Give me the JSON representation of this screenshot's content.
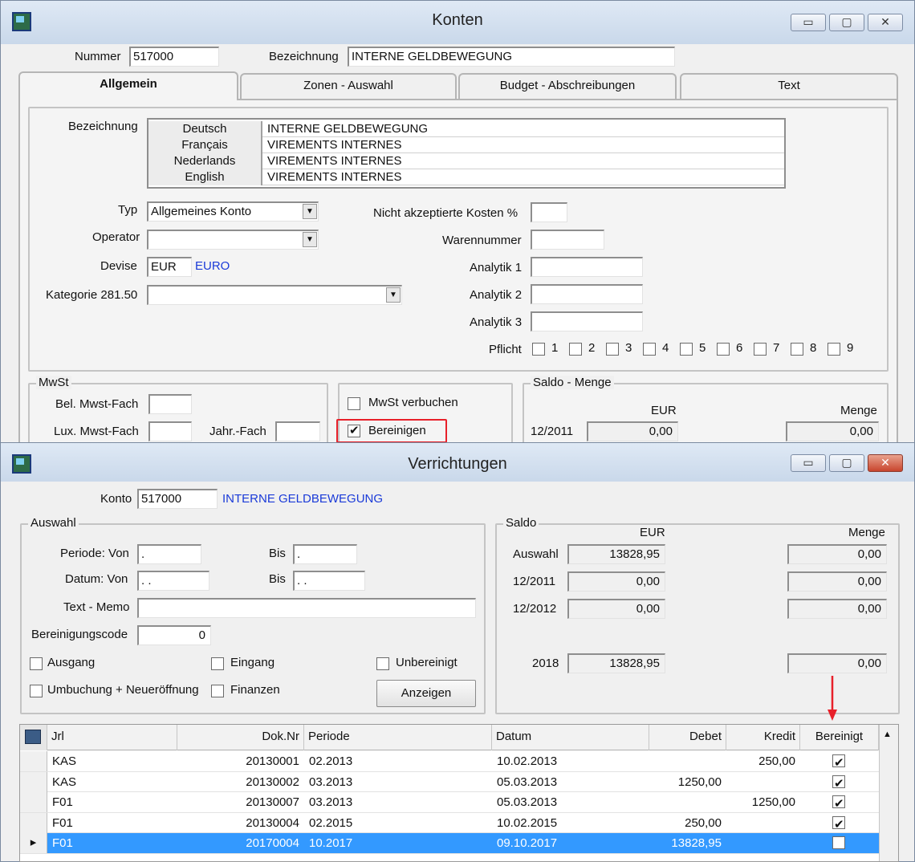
{
  "konten": {
    "title": "Konten",
    "nummer_label": "Nummer",
    "nummer_value": "517000",
    "bezeichnung_label": "Bezeichnung",
    "bezeichnung_value": "INTERNE GELDBEWEGUNG",
    "tabs": [
      "Allgemein",
      "Zonen - Auswahl",
      "Budget - Abschreibungen",
      "Text"
    ],
    "languages_label": "Bezeichnung",
    "languages": [
      {
        "lang": "Deutsch",
        "text": "INTERNE GELDBEWEGUNG"
      },
      {
        "lang": "Français",
        "text": "VIREMENTS INTERNES"
      },
      {
        "lang": "Nederlands",
        "text": "VIREMENTS INTERNES"
      },
      {
        "lang": "English",
        "text": "VIREMENTS INTERNES"
      }
    ],
    "typ_label": "Typ",
    "typ_value": "Allgemeines Konto",
    "operator_label": "Operator",
    "operator_value": "",
    "devise_label": "Devise",
    "devise_code": "EUR",
    "devise_name": "EURO",
    "kategorie_label": "Kategorie 281.50",
    "kategorie_value": "",
    "nicht_label": "Nicht akzeptierte Kosten %",
    "warennummer_label": "Warennummer",
    "analytik_labels": [
      "Analytik 1",
      "Analytik 2",
      "Analytik 3"
    ],
    "pflicht_label": "Pflicht",
    "pflicht_numbers": [
      "1",
      "2",
      "3",
      "4",
      "5",
      "6",
      "7",
      "8",
      "9"
    ],
    "mwst_group": "MwSt",
    "bel_label": "Bel. Mwst-Fach",
    "lux_label": "Lux. Mwst-Fach",
    "jahr_label": "Jahr.-Fach",
    "mwst_verbuchen_label": "MwSt verbuchen",
    "mwst_verbuchen_checked": false,
    "bereinigen_label": "Bereinigen",
    "bereinigen_checked": true,
    "saldo_group": "Saldo - Menge",
    "saldo_eur_header": "EUR",
    "saldo_menge_header": "Menge",
    "saldo_period": "12/2011",
    "saldo_eur": "0,00",
    "saldo_menge": "0,00",
    "highlight_color": "#e8202a"
  },
  "verrichtungen": {
    "title": "Verrichtungen",
    "konto_label": "Konto",
    "konto_value": "517000",
    "konto_name": "INTERNE GELDBEWEGUNG",
    "auswahl_group": "Auswahl",
    "periode_label": "Periode: Von",
    "periode_von": ".",
    "periode_bis": ".",
    "bis_label": "Bis",
    "datum_label": "Datum: Von",
    "datum_von": ". .",
    "datum_bis": ". .",
    "memo_label": "Text - Memo",
    "bereinigungscode_label": "Bereinigungscode",
    "bereinigungscode_value": "0",
    "filters": {
      "ausgang": "Ausgang",
      "eingang": "Eingang",
      "unbereinigt": "Unbereinigt",
      "umbuchung": "Umbuchung + Neueröffnung",
      "finanzen": "Finanzen"
    },
    "anzeigen_label": "Anzeigen",
    "saldo_group": "Saldo",
    "saldo_eur_header": "EUR",
    "saldo_menge_header": "Menge",
    "saldo_rows": [
      {
        "label": "Auswahl",
        "eur": "13828,95",
        "menge": "0,00"
      },
      {
        "label": "12/2011",
        "eur": "0,00",
        "menge": "0,00"
      },
      {
        "label": "12/2012",
        "eur": "0,00",
        "menge": "0,00"
      },
      {
        "label": "2018",
        "eur": "13828,95",
        "menge": "0,00"
      }
    ],
    "grid_columns": [
      "Jrl",
      "Dok.Nr",
      "Periode",
      "Datum",
      "Debet",
      "Kredit",
      "Bereinigt"
    ],
    "grid_rows": [
      {
        "jrl": "KAS",
        "doknr": "20130001",
        "periode": "02.2013",
        "datum": "10.02.2013",
        "debet": "",
        "kredit": "250,00",
        "bereinigt": true,
        "selected": false
      },
      {
        "jrl": "KAS",
        "doknr": "20130002",
        "periode": "03.2013",
        "datum": "05.03.2013",
        "debet": "1250,00",
        "kredit": "",
        "bereinigt": true,
        "selected": false
      },
      {
        "jrl": "F01",
        "doknr": "20130007",
        "periode": "03.2013",
        "datum": "05.03.2013",
        "debet": "",
        "kredit": "1250,00",
        "bereinigt": true,
        "selected": false
      },
      {
        "jrl": "F01",
        "doknr": "20130004",
        "periode": "02.2015",
        "datum": "10.02.2015",
        "debet": "250,00",
        "kredit": "",
        "bereinigt": true,
        "selected": false
      },
      {
        "jrl": "F01",
        "doknr": "20170004",
        "periode": "10.2017",
        "datum": "09.10.2017",
        "debet": "13828,95",
        "kredit": "",
        "bereinigt": false,
        "selected": true
      }
    ],
    "selection_color": "#3399ff"
  }
}
